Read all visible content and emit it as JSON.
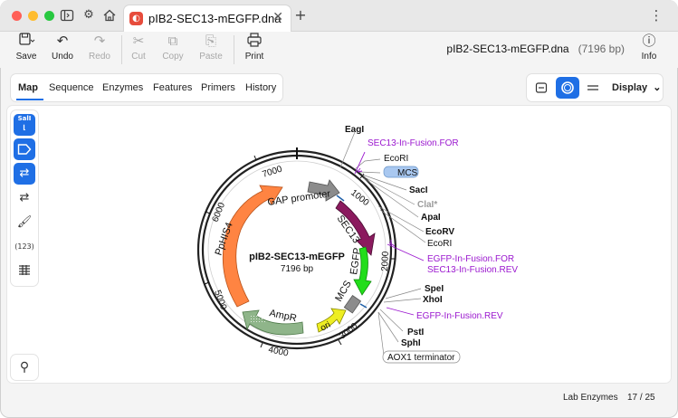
{
  "window": {
    "tab_title": "pIB2-SEC13-mEGFP.dna",
    "tab_close": "✕",
    "new_tab": "+",
    "menu": "⋮"
  },
  "toolbar": {
    "save": "Save",
    "undo": "Undo",
    "redo": "Redo",
    "cut": "Cut",
    "copy": "Copy",
    "paste": "Paste",
    "print": "Print",
    "info": "Info",
    "doc_name": "pIB2-SEC13-mEGFP.dna",
    "doc_size": "(7196 bp)"
  },
  "nav": {
    "tabs": [
      "Map",
      "Sequence",
      "Enzymes",
      "Features",
      "Primers",
      "History"
    ],
    "active": "Map",
    "display": "Display"
  },
  "sidebar": {
    "saii_label": "SalI",
    "count_label": "(123)"
  },
  "map": {
    "name": "pIB2-SEC13-mEGFP",
    "size": "7196 bp",
    "ticks": [
      "1000",
      "2000",
      "3000",
      "4000",
      "5000",
      "6000",
      "7000"
    ],
    "features": {
      "gap": "GAP promoter",
      "sec13": "SEC13",
      "egfp": "EGFP",
      "mcs_inner": "MCS",
      "pphis4": "PpHIS4",
      "ampr": "AmpR",
      "ori": "ori"
    },
    "labels": {
      "eagi": "EagI",
      "sec13_fwd": "SEC13-In-Fusion.FOR",
      "ecori_top": "EcoRI",
      "mcs_top": "MCS",
      "saci": "SacI",
      "clai": "ClaI*",
      "apai": "ApaI",
      "ecorv": "EcoRV",
      "ecori_mid": "EcoRI",
      "egfp_fwd": "EGFP-In-Fusion.FOR",
      "sec13_rev": "SEC13-In-Fusion.REV",
      "spei": "SpeI",
      "xhoi": "XhoI",
      "egfp_rev": "EGFP-In-Fusion.REV",
      "psti": "PstI",
      "sphi": "SphI",
      "aox1": "AOX1 terminator"
    },
    "colors": {
      "gap": "#8c8c8c",
      "sec13": "#8b1a5e",
      "egfp": "#22dd1a",
      "mcs": "#8c8c8c",
      "pphis4": "#ff8442",
      "ampr": "#8fb58a",
      "ori": "#eeee22",
      "primer": "#9b18cf",
      "clai": "#9b9b9b"
    }
  },
  "status": {
    "enzymes": "Lab Enzymes",
    "count": "17 / 25"
  }
}
